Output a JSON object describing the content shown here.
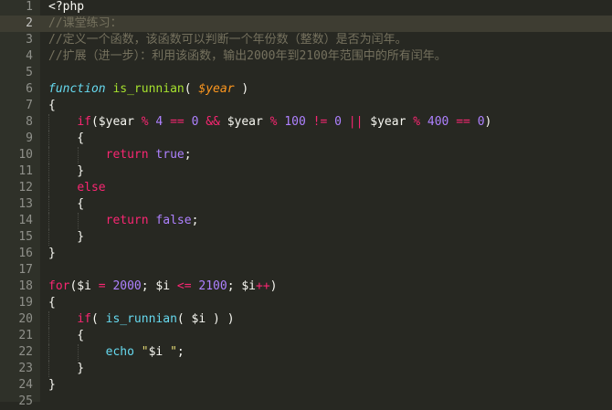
{
  "editor": {
    "colors": {
      "background": "#272822",
      "gutter": "#2f3129",
      "line_number": "#8f908a",
      "active_line": "#3e3d32",
      "default": "#f8f8f2",
      "keyword": "#f92672",
      "storage": "#66d9ef",
      "function_name": "#a6e22e",
      "parameter": "#fd971f",
      "number": "#ae81ff",
      "string": "#e6db74",
      "comment": "#75715e"
    },
    "active_line": 2,
    "lines": [
      {
        "number": "1",
        "indent": 0,
        "tokens": [
          {
            "t": "<?php",
            "c": "default"
          }
        ]
      },
      {
        "number": "2",
        "indent": 0,
        "tokens": [
          {
            "t": "//课堂练习：",
            "c": "comment"
          }
        ]
      },
      {
        "number": "3",
        "indent": 0,
        "tokens": [
          {
            "t": "//定义一个函数，该函数可以判断一个年份数（整数）是否为闰年。",
            "c": "comment"
          }
        ]
      },
      {
        "number": "4",
        "indent": 0,
        "tokens": [
          {
            "t": "//扩展（进一步）：利用该函数，输出2000年到2100年范围中的所有闰年。",
            "c": "comment"
          }
        ]
      },
      {
        "number": "5",
        "indent": 0,
        "tokens": []
      },
      {
        "number": "6",
        "indent": 0,
        "tokens": [
          {
            "t": "function",
            "c": "storage",
            "i": true
          },
          {
            "t": " ",
            "c": "default"
          },
          {
            "t": "is_runnian",
            "c": "function_name"
          },
          {
            "t": "( ",
            "c": "default"
          },
          {
            "t": "$year",
            "c": "parameter",
            "i": true
          },
          {
            "t": " )",
            "c": "default"
          }
        ]
      },
      {
        "number": "7",
        "indent": 0,
        "tokens": [
          {
            "t": "{",
            "c": "default"
          }
        ]
      },
      {
        "number": "8",
        "indent": 1,
        "tokens": [
          {
            "t": "    ",
            "c": "default"
          },
          {
            "t": "if",
            "c": "keyword"
          },
          {
            "t": "($year ",
            "c": "default"
          },
          {
            "t": "%",
            "c": "keyword"
          },
          {
            "t": " ",
            "c": "default"
          },
          {
            "t": "4",
            "c": "number"
          },
          {
            "t": " ",
            "c": "default"
          },
          {
            "t": "==",
            "c": "keyword"
          },
          {
            "t": " ",
            "c": "default"
          },
          {
            "t": "0",
            "c": "number"
          },
          {
            "t": " ",
            "c": "default"
          },
          {
            "t": "&&",
            "c": "keyword"
          },
          {
            "t": " $year ",
            "c": "default"
          },
          {
            "t": "%",
            "c": "keyword"
          },
          {
            "t": " ",
            "c": "default"
          },
          {
            "t": "100",
            "c": "number"
          },
          {
            "t": " ",
            "c": "default"
          },
          {
            "t": "!=",
            "c": "keyword"
          },
          {
            "t": " ",
            "c": "default"
          },
          {
            "t": "0",
            "c": "number"
          },
          {
            "t": " ",
            "c": "default"
          },
          {
            "t": "||",
            "c": "keyword"
          },
          {
            "t": " $year ",
            "c": "default"
          },
          {
            "t": "%",
            "c": "keyword"
          },
          {
            "t": " ",
            "c": "default"
          },
          {
            "t": "400",
            "c": "number"
          },
          {
            "t": " ",
            "c": "default"
          },
          {
            "t": "==",
            "c": "keyword"
          },
          {
            "t": " ",
            "c": "default"
          },
          {
            "t": "0",
            "c": "number"
          },
          {
            "t": ")",
            "c": "default"
          }
        ]
      },
      {
        "number": "9",
        "indent": 1,
        "tokens": [
          {
            "t": "    {",
            "c": "default"
          }
        ]
      },
      {
        "number": "10",
        "indent": 2,
        "tokens": [
          {
            "t": "        ",
            "c": "default"
          },
          {
            "t": "return",
            "c": "keyword"
          },
          {
            "t": " ",
            "c": "default"
          },
          {
            "t": "true",
            "c": "number"
          },
          {
            "t": ";",
            "c": "default"
          }
        ]
      },
      {
        "number": "11",
        "indent": 1,
        "tokens": [
          {
            "t": "    }",
            "c": "default"
          }
        ]
      },
      {
        "number": "12",
        "indent": 1,
        "tokens": [
          {
            "t": "    ",
            "c": "default"
          },
          {
            "t": "else",
            "c": "keyword"
          }
        ]
      },
      {
        "number": "13",
        "indent": 1,
        "tokens": [
          {
            "t": "    {",
            "c": "default"
          }
        ]
      },
      {
        "number": "14",
        "indent": 2,
        "tokens": [
          {
            "t": "        ",
            "c": "default"
          },
          {
            "t": "return",
            "c": "keyword"
          },
          {
            "t": " ",
            "c": "default"
          },
          {
            "t": "false",
            "c": "number"
          },
          {
            "t": ";",
            "c": "default"
          }
        ]
      },
      {
        "number": "15",
        "indent": 1,
        "tokens": [
          {
            "t": "    }",
            "c": "default"
          }
        ]
      },
      {
        "number": "16",
        "indent": 0,
        "tokens": [
          {
            "t": "}",
            "c": "default"
          }
        ]
      },
      {
        "number": "17",
        "indent": 0,
        "tokens": []
      },
      {
        "number": "18",
        "indent": 0,
        "tokens": [
          {
            "t": "for",
            "c": "keyword"
          },
          {
            "t": "($i ",
            "c": "default"
          },
          {
            "t": "=",
            "c": "keyword"
          },
          {
            "t": " ",
            "c": "default"
          },
          {
            "t": "2000",
            "c": "number"
          },
          {
            "t": "; $i ",
            "c": "default"
          },
          {
            "t": "<=",
            "c": "keyword"
          },
          {
            "t": " ",
            "c": "default"
          },
          {
            "t": "2100",
            "c": "number"
          },
          {
            "t": "; $i",
            "c": "default"
          },
          {
            "t": "++",
            "c": "keyword"
          },
          {
            "t": ")",
            "c": "default"
          }
        ]
      },
      {
        "number": "19",
        "indent": 0,
        "tokens": [
          {
            "t": "{",
            "c": "default"
          }
        ]
      },
      {
        "number": "20",
        "indent": 1,
        "tokens": [
          {
            "t": "    ",
            "c": "default"
          },
          {
            "t": "if",
            "c": "keyword"
          },
          {
            "t": "( ",
            "c": "default"
          },
          {
            "t": "is_runnian",
            "c": "storage"
          },
          {
            "t": "( $i ) )",
            "c": "default"
          }
        ]
      },
      {
        "number": "21",
        "indent": 1,
        "tokens": [
          {
            "t": "    {",
            "c": "default"
          }
        ]
      },
      {
        "number": "22",
        "indent": 2,
        "tokens": [
          {
            "t": "        ",
            "c": "default"
          },
          {
            "t": "echo",
            "c": "storage"
          },
          {
            "t": " ",
            "c": "default"
          },
          {
            "t": "\"",
            "c": "string"
          },
          {
            "t": "$i",
            "c": "default"
          },
          {
            "t": " \"",
            "c": "string"
          },
          {
            "t": ";",
            "c": "default"
          }
        ]
      },
      {
        "number": "23",
        "indent": 1,
        "tokens": [
          {
            "t": "    }",
            "c": "default"
          }
        ]
      },
      {
        "number": "24",
        "indent": 0,
        "tokens": [
          {
            "t": "}",
            "c": "default"
          }
        ]
      },
      {
        "number": "25",
        "indent": 0,
        "tokens": []
      }
    ]
  }
}
